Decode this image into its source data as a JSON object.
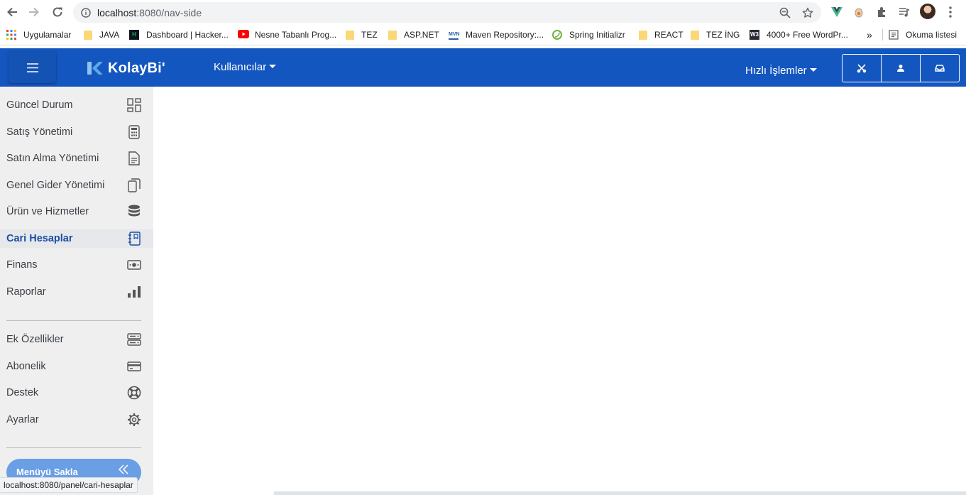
{
  "browser": {
    "url_host": "localhost",
    "url_path": ":8080/nav-side",
    "bookmarks": [
      {
        "label": "Uygulamalar",
        "icon": "apps-grid-icon"
      },
      {
        "label": "JAVA",
        "icon": "folder-icon"
      },
      {
        "label": "Dashboard | Hacker...",
        "icon": "hackerrank-icon"
      },
      {
        "label": "Nesne Tabanlı Prog...",
        "icon": "youtube-icon"
      },
      {
        "label": "TEZ",
        "icon": "folder-icon"
      },
      {
        "label": "ASP.NET",
        "icon": "folder-icon"
      },
      {
        "label": "Maven Repository:...",
        "icon": "maven-icon"
      },
      {
        "label": "Spring Initializr",
        "icon": "spring-icon"
      },
      {
        "label": "REACT",
        "icon": "folder-icon"
      },
      {
        "label": "TEZ İNG",
        "icon": "folder-icon"
      },
      {
        "label": "4000+ Free WordPr...",
        "icon": "w3-icon"
      }
    ],
    "overflow_label": "»",
    "reading_list_label": "Okuma listesi",
    "status_url": "localhost:8080/panel/cari-hesaplar"
  },
  "app": {
    "logo_text": "KolayBi'",
    "users_menu": "Kullanıcılar",
    "quick_actions": "Hızlı İşlemler",
    "tools": [
      "tools-icon",
      "user-icon",
      "inbox-icon"
    ],
    "colors": {
      "header": "#1356bf",
      "active_text": "#1a4fa3",
      "sidebar_bg": "#efefef"
    }
  },
  "sidebar": {
    "items": [
      {
        "label": "Güncel Durum",
        "icon": "dashboard-grid-icon"
      },
      {
        "label": "Satış Yönetimi",
        "icon": "calculator-icon"
      },
      {
        "label": "Satın Alma Yönetimi",
        "icon": "document-icon"
      },
      {
        "label": "Genel Gider Yönetimi",
        "icon": "copy-icon"
      },
      {
        "label": "Ürün ve Hizmetler",
        "icon": "database-icon"
      },
      {
        "label": "Cari Hesaplar",
        "icon": "address-book-icon",
        "active": true
      },
      {
        "label": "Finans",
        "icon": "cash-icon"
      },
      {
        "label": "Raporlar",
        "icon": "bar-chart-icon"
      }
    ],
    "extra_items": [
      {
        "label": "Ek Özellikler",
        "icon": "server-icon"
      },
      {
        "label": "Abonelik",
        "icon": "credit-card-icon"
      },
      {
        "label": "Destek",
        "icon": "lifebuoy-icon"
      },
      {
        "label": "Ayarlar",
        "icon": "gear-icon"
      }
    ],
    "hide_label": "Menüyü Sakla"
  }
}
